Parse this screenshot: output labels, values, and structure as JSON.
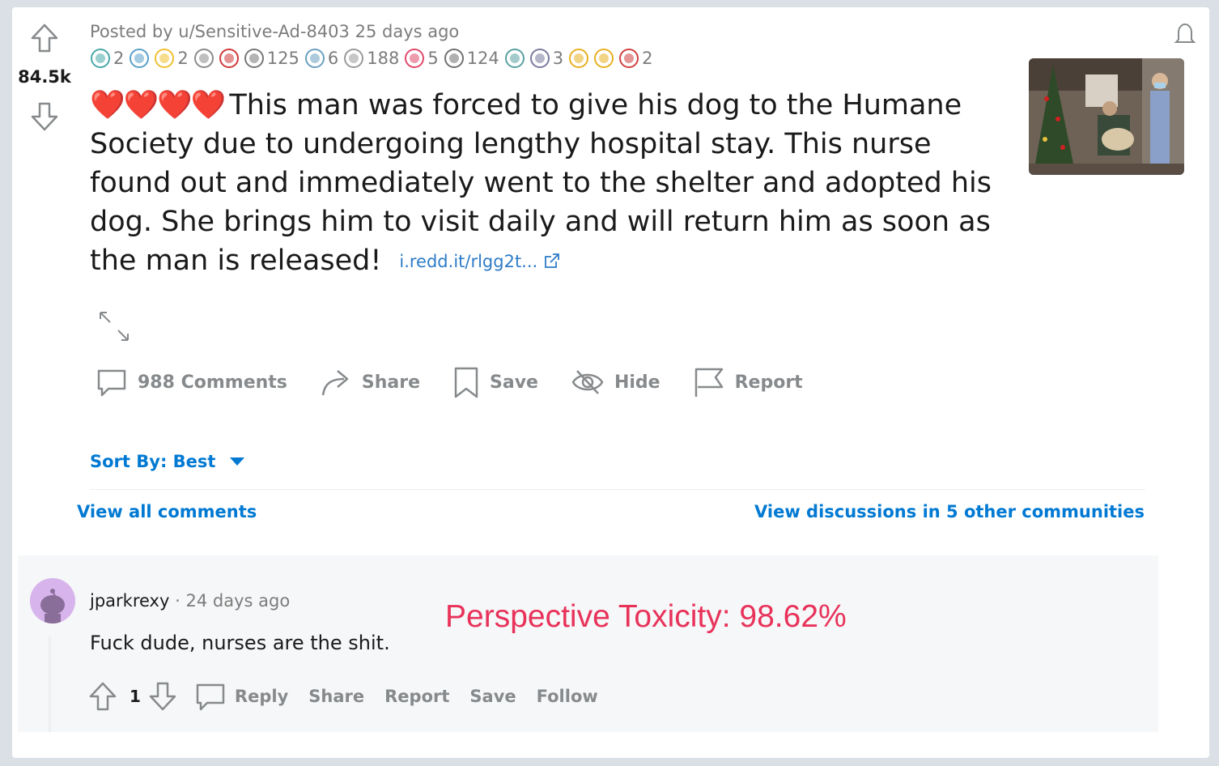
{
  "post": {
    "score": "84.5k",
    "posted_by": "Posted by u/Sensitive-Ad-8403",
    "time_ago": "25 days ago",
    "awards": [
      {
        "icon": "medal-award-icon",
        "count": "2",
        "color": "#4aa8a8"
      },
      {
        "icon": "wholesome-award-icon",
        "count": "",
        "color": "#5aa0c8"
      },
      {
        "icon": "gold-star-award-icon",
        "count": "2",
        "color": "#f0c030"
      },
      {
        "icon": "hugz-award-icon",
        "count": "",
        "color": "#8a8a8a"
      },
      {
        "icon": "heart-award-icon",
        "count": "",
        "color": "#d0383a"
      },
      {
        "icon": "handshake-award-icon",
        "count": "125",
        "color": "#777777"
      },
      {
        "icon": "angel-award-icon",
        "count": "6",
        "color": "#6aa0c0"
      },
      {
        "icon": "silver-face-award-icon",
        "count": "188",
        "color": "#999999"
      },
      {
        "icon": "heart-eyes-award-icon",
        "count": "5",
        "color": "#e04a6a"
      },
      {
        "icon": "silver-coin-award-icon",
        "count": "124",
        "color": "#707070"
      },
      {
        "icon": "snoo-award-icon",
        "count": "",
        "color": "#5aa0a0"
      },
      {
        "icon": "thinking-award-icon",
        "count": "3",
        "color": "#7a7aa0"
      },
      {
        "icon": "pyramid-award-icon",
        "count": "",
        "color": "#e8b020"
      },
      {
        "icon": "sun-award-icon",
        "count": "",
        "color": "#e8b020"
      },
      {
        "icon": "party-award-icon",
        "count": "2",
        "color": "#d04040"
      }
    ],
    "hearts": "❤️❤️❤️❤️",
    "title": "This man was forced to give his dog to the Humane Society due to undergoing lengthy hospital stay. This nurse found out and immediately went to the shelter and adopted his dog. She brings him to visit daily and will return him as soon as the man is released!",
    "link": "i.redd.it/rlgg2t...",
    "actions": {
      "comments": "988 Comments",
      "share": "Share",
      "save": "Save",
      "hide": "Hide",
      "report": "Report"
    }
  },
  "sort": {
    "label": "Sort By: Best"
  },
  "view_all": "View all comments",
  "view_discussions": "View discussions in 5 other communities",
  "comment": {
    "author": "jparkrexy",
    "separator": "·",
    "time_ago": "24 days ago",
    "body": "Fuck dude, nurses are the shit.",
    "votes": "1",
    "actions": {
      "reply": "Reply",
      "share": "Share",
      "report": "Report",
      "save": "Save",
      "follow": "Follow"
    }
  },
  "toxicity_label": "Perspective Toxicity: 98.62%",
  "colors": {
    "accent": "#0079d3",
    "toxicity": "#e8325a",
    "muted": "#878a8c"
  }
}
